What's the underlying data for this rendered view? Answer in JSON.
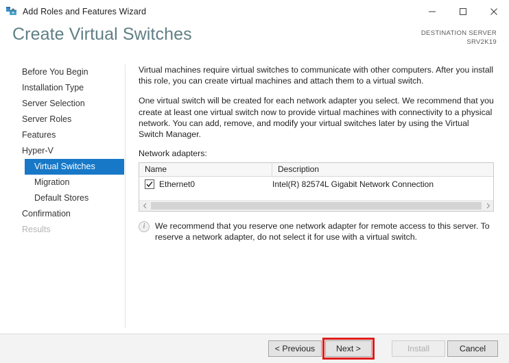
{
  "window": {
    "title": "Add Roles and Features Wizard",
    "icon": "server-manager-icon",
    "controls": {
      "minimize": "minimize-icon",
      "maximize": "maximize-icon",
      "close": "close-icon"
    }
  },
  "header": {
    "page_title": "Create Virtual Switches",
    "destination_label": "DESTINATION SERVER",
    "destination_server": "SRV2K19"
  },
  "sidebar": {
    "items": [
      {
        "label": "Before You Begin",
        "state": "normal",
        "level": 0
      },
      {
        "label": "Installation Type",
        "state": "normal",
        "level": 0
      },
      {
        "label": "Server Selection",
        "state": "normal",
        "level": 0
      },
      {
        "label": "Server Roles",
        "state": "normal",
        "level": 0
      },
      {
        "label": "Features",
        "state": "normal",
        "level": 0
      },
      {
        "label": "Hyper-V",
        "state": "normal",
        "level": 0
      },
      {
        "label": "Virtual Switches",
        "state": "selected",
        "level": 1
      },
      {
        "label": "Migration",
        "state": "normal",
        "level": 1
      },
      {
        "label": "Default Stores",
        "state": "normal",
        "level": 1
      },
      {
        "label": "Confirmation",
        "state": "normal",
        "level": 0
      },
      {
        "label": "Results",
        "state": "disabled",
        "level": 0
      }
    ]
  },
  "main": {
    "paragraph1": "Virtual machines require virtual switches to communicate with other computers. After you install this role, you can create virtual machines and attach them to a virtual switch.",
    "paragraph2": "One virtual switch will be created for each network adapter you select. We recommend that you create at least one virtual switch now to provide virtual machines with connectivity to a physical network. You can add, remove, and modify your virtual switches later by using the Virtual Switch Manager.",
    "adapters_label": "Network adapters:",
    "table": {
      "columns": [
        "Name",
        "Description"
      ],
      "rows": [
        {
          "checked": true,
          "name": "Ethernet0",
          "description": "Intel(R) 82574L Gigabit Network Connection"
        }
      ]
    },
    "note": {
      "icon": "info-icon",
      "glyph": "i",
      "text": "We recommend that you reserve one network adapter for remote access to this server. To reserve a network adapter, do not select it for use with a virtual switch."
    }
  },
  "footer": {
    "previous_label": "< Previous",
    "next_label": "Next >",
    "install_label": "Install",
    "cancel_label": "Cancel",
    "install_disabled": true,
    "highlight_color": "#e01b1b",
    "highlighted_button": "Next >"
  }
}
